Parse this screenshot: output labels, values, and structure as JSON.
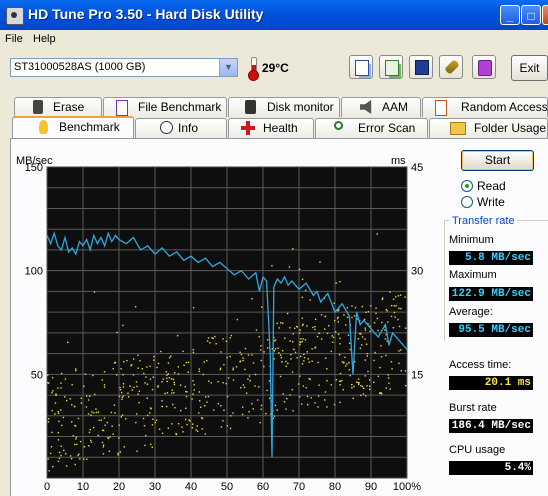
{
  "window": {
    "title": "HD Tune Pro 3.50 - Hard Disk Utility",
    "minimize": "_",
    "maximize": "□",
    "close": "×"
  },
  "menu": {
    "file": "File",
    "help": "Help"
  },
  "toolbar": {
    "drive": "ST31000528AS (1000 GB)",
    "temperature": "29°C",
    "exit_label": "Exit"
  },
  "tabs_top": [
    "Erase",
    "File Benchmark",
    "Disk monitor",
    "AAM",
    "Random Access"
  ],
  "tabs_bottom": [
    "Benchmark",
    "Info",
    "Health",
    "Error Scan",
    "Folder Usage"
  ],
  "active_tab": "Benchmark",
  "controls": {
    "start_label": "Start",
    "read_label": "Read",
    "write_label": "Write",
    "selected": "Read"
  },
  "stats": {
    "group_title": "Transfer rate",
    "minimum_label": "Minimum",
    "minimum_value": "5.8 MB/sec",
    "maximum_label": "Maximum",
    "maximum_value": "122.9 MB/sec",
    "average_label": "Average:",
    "average_value": "95.5 MB/sec",
    "access_label": "Access time:",
    "access_value": "20.1 ms",
    "burst_label": "Burst rate",
    "burst_value": "186.4 MB/sec",
    "cpu_label": "CPU usage",
    "cpu_value": "5.4%"
  },
  "colors": {
    "transfer_line": "#2ea8e0",
    "access_dots": "#e8d83a",
    "plot_bg": "#0e0e0e",
    "grid": "#5a5a5a"
  },
  "chart_data": {
    "type": "line",
    "left_axis_label": "MB/sec",
    "right_axis_label": "ms",
    "left_ticks": [
      "150",
      "100",
      "50"
    ],
    "right_ticks": [
      "45",
      "30",
      "15"
    ],
    "x_ticks": [
      "0",
      "10",
      "20",
      "30",
      "40",
      "50",
      "60",
      "70",
      "80",
      "90",
      "100%"
    ],
    "xlim": [
      0,
      100
    ],
    "ylim_left": [
      0,
      150
    ],
    "ylim_right": [
      0,
      45
    ],
    "grid": true,
    "series": [
      {
        "kind": "transfer-rate",
        "color": "#2ea8e0",
        "x": [
          0,
          1,
          2,
          3,
          4,
          5,
          6,
          7,
          8,
          9,
          10,
          11,
          12,
          13,
          14,
          15,
          16,
          17,
          18,
          19,
          20,
          22,
          24,
          26,
          28,
          30,
          32,
          34,
          36,
          38,
          40,
          42,
          44,
          46,
          48,
          50,
          52,
          54,
          56,
          58,
          59,
          60,
          61,
          62,
          62.5,
          63,
          64,
          65,
          66,
          67,
          68,
          70,
          72,
          74,
          75,
          76,
          78,
          80,
          82,
          84,
          85,
          86,
          87,
          88,
          90,
          92,
          94,
          95,
          96,
          98,
          100
        ],
        "y": [
          117,
          113,
          118,
          112,
          110,
          116,
          109,
          111,
          108,
          114,
          112,
          115,
          110,
          117,
          113,
          116,
          112,
          118,
          114,
          117,
          115,
          113,
          116,
          110,
          112,
          108,
          111,
          107,
          109,
          105,
          107,
          104,
          106,
          102,
          104,
          101,
          98,
          100,
          96,
          99,
          90,
          97,
          95,
          60,
          10,
          92,
          96,
          94,
          97,
          93,
          95,
          91,
          94,
          88,
          90,
          85,
          89,
          80,
          84,
          78,
          50,
          80,
          74,
          76,
          72,
          68,
          74,
          64,
          70,
          66,
          62
        ]
      }
    ],
    "scatter_note": "access time samples (ms) — yellow dots"
  }
}
